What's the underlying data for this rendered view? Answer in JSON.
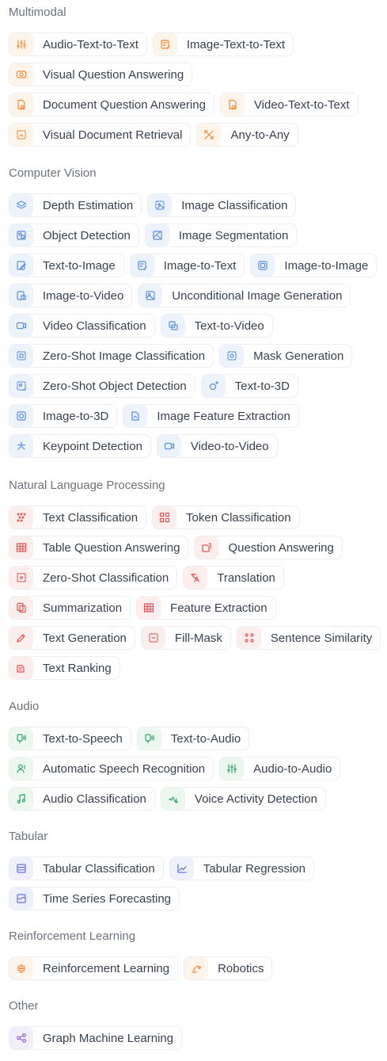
{
  "colors": {
    "Multimodal": "#f08a3c",
    "Computer Vision": "#5b8fe0",
    "Natural Language Processing": "#e25555",
    "Audio": "#34a36a",
    "Tabular": "#6970d8",
    "Reinforcement Learning": "#f08a3c",
    "Other": "#9063d8"
  },
  "sections": [
    {
      "title": "Multimodal",
      "color": "orange",
      "rows": [
        [
          {
            "label": "Audio-Text-to-Text",
            "icon": "sliders-icon"
          },
          {
            "label": "Image-Text-to-Text",
            "icon": "image-edit-icon"
          }
        ],
        [
          {
            "label": "Visual Question Answering",
            "icon": "eye-icon"
          }
        ],
        [
          {
            "label": "Document Question Answering",
            "icon": "document-question-icon"
          },
          {
            "label": "Video-Text-to-Text",
            "icon": "document-question-icon"
          }
        ],
        [
          {
            "label": "Visual Document Retrieval",
            "icon": "document-image-icon"
          },
          {
            "label": "Any-to-Any",
            "icon": "arrows-cross-icon"
          }
        ]
      ]
    },
    {
      "title": "Computer Vision",
      "color": "blue",
      "rows": [
        [
          {
            "label": "Depth Estimation",
            "icon": "layers-icon"
          },
          {
            "label": "Image Classification",
            "icon": "image-tag-icon"
          }
        ],
        [
          {
            "label": "Object Detection",
            "icon": "object-box-icon"
          },
          {
            "label": "Image Segmentation",
            "icon": "image-segment-icon"
          }
        ],
        [
          {
            "label": "Text-to-Image",
            "icon": "pencil-image-icon"
          },
          {
            "label": "Image-to-Text",
            "icon": "image-text-icon"
          },
          {
            "label": "Image-to-Image",
            "icon": "image-image-icon"
          }
        ],
        [
          {
            "label": "Image-to-Video",
            "icon": "image-video-icon"
          },
          {
            "label": "Unconditional Image Generation",
            "icon": "image-icon"
          }
        ],
        [
          {
            "label": "Video Classification",
            "icon": "video-icon"
          },
          {
            "label": "Text-to-Video",
            "icon": "text-video-icon"
          }
        ],
        [
          {
            "label": "Zero-Shot Image Classification",
            "icon": "dashed-image-icon"
          },
          {
            "label": "Mask Generation",
            "icon": "mask-icon"
          }
        ],
        [
          {
            "label": "Zero-Shot Object Detection",
            "icon": "dashed-object-icon"
          },
          {
            "label": "Text-to-3D",
            "icon": "sparkle-3d-icon"
          }
        ],
        [
          {
            "label": "Image-to-3D",
            "icon": "cube-icon"
          },
          {
            "label": "Image Feature Extraction",
            "icon": "image-feature-icon"
          }
        ],
        [
          {
            "label": "Keypoint Detection",
            "icon": "keypoint-icon"
          },
          {
            "label": "Video-to-Video",
            "icon": "camera-icon"
          }
        ]
      ]
    },
    {
      "title": "Natural Language Processing",
      "color": "red",
      "rows": [
        [
          {
            "label": "Text Classification",
            "icon": "dots-icon"
          },
          {
            "label": "Token Classification",
            "icon": "token-icon"
          }
        ],
        [
          {
            "label": "Table Question Answering",
            "icon": "table-icon"
          },
          {
            "label": "Question Answering",
            "icon": "question-icon"
          }
        ],
        [
          {
            "label": "Zero-Shot Classification",
            "icon": "dashed-dots-icon"
          },
          {
            "label": "Translation",
            "icon": "translate-icon"
          }
        ],
        [
          {
            "label": "Summarization",
            "icon": "copy-icon"
          },
          {
            "label": "Feature Extraction",
            "icon": "grid-icon"
          }
        ],
        [
          {
            "label": "Text Generation",
            "icon": "pencil-icon"
          },
          {
            "label": "Fill-Mask",
            "icon": "fill-mask-icon"
          },
          {
            "label": "Sentence Similarity",
            "icon": "similarity-icon"
          }
        ],
        [
          {
            "label": "Text Ranking",
            "icon": "ranking-icon"
          }
        ]
      ]
    },
    {
      "title": "Audio",
      "color": "green",
      "rows": [
        [
          {
            "label": "Text-to-Speech",
            "icon": "speech-icon"
          },
          {
            "label": "Text-to-Audio",
            "icon": "speech-icon"
          }
        ],
        [
          {
            "label": "Automatic Speech Recognition",
            "icon": "user-voice-icon"
          },
          {
            "label": "Audio-to-Audio",
            "icon": "sliders-icon"
          }
        ],
        [
          {
            "label": "Audio Classification",
            "icon": "music-note-icon"
          },
          {
            "label": "Voice Activity Detection",
            "icon": "voice-wave-icon"
          }
        ]
      ]
    },
    {
      "title": "Tabular",
      "color": "indigo",
      "rows": [
        [
          {
            "label": "Tabular Classification",
            "icon": "list-icon"
          },
          {
            "label": "Tabular Regression",
            "icon": "line-chart-icon"
          }
        ],
        [
          {
            "label": "Time Series Forecasting",
            "icon": "wave-chart-icon"
          }
        ]
      ]
    },
    {
      "title": "Reinforcement Learning",
      "color": "orange",
      "rows": [
        [
          {
            "label": "Reinforcement Learning",
            "icon": "robot-head-icon"
          },
          {
            "label": "Robotics",
            "icon": "robot-arm-icon"
          }
        ]
      ]
    },
    {
      "title": "Other",
      "color": "purple",
      "rows": [
        [
          {
            "label": "Graph Machine Learning",
            "icon": "graph-nodes-icon"
          }
        ]
      ]
    }
  ]
}
